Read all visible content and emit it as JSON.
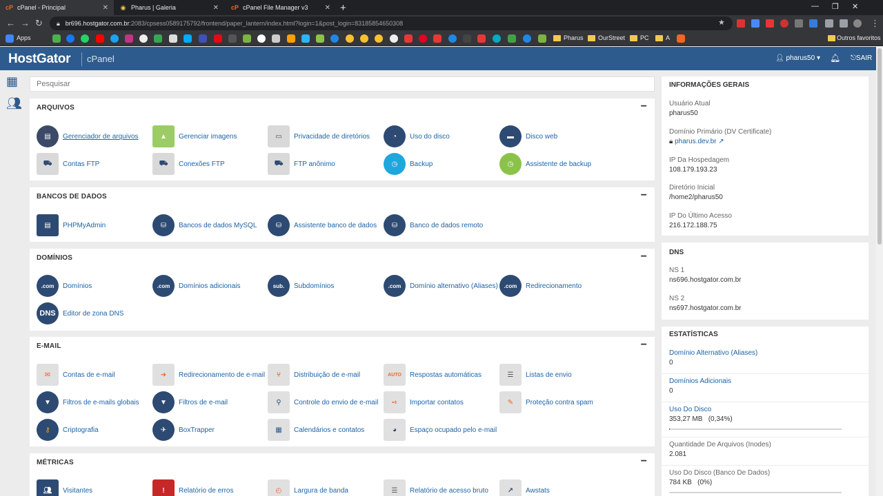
{
  "browser": {
    "tabs": [
      {
        "title": "cPanel - Principal",
        "active": true,
        "icon": "cpanel-icon"
      },
      {
        "title": "Pharus | Galeria",
        "active": false,
        "icon": "pharus-icon"
      },
      {
        "title": "cPanel File Manager v3",
        "active": false,
        "icon": "cpanel-icon"
      }
    ],
    "url_host": "br696.hostgator.com.br",
    "url_rest": ":2083/cpsess0589175792/frontend/paper_lantern/index.html?login=1&post_login=83185854650308",
    "bookmarks": {
      "apps": "Apps",
      "folders": [
        "Pharus",
        "OurStreet",
        "PC",
        "A"
      ],
      "other": "Outros favoritos"
    }
  },
  "header": {
    "logo": "HostGator",
    "sub": "cPanel",
    "user": "pharus50",
    "exit": "SAIR"
  },
  "search": {
    "placeholder": "Pesquisar"
  },
  "sections": {
    "arquivos": {
      "title": "ARQUIVOS",
      "items": [
        "Gerenciador de arquivos",
        "Gerenciar imagens",
        "Privacidade de diretórios",
        "Uso do disco",
        "Disco web",
        "Contas FTP",
        "Conexões FTP",
        "FTP anônimo",
        "Backup",
        "Assistente de backup"
      ]
    },
    "bancos": {
      "title": "BANCOS DE DADOS",
      "items": [
        "PHPMyAdmin",
        "Bancos de dados MySQL",
        "Assistente banco de dados",
        "Banco de dados remoto"
      ]
    },
    "dominios": {
      "title": "DOMÍNIOS",
      "items": [
        "Domínios",
        "Domínios adicionais",
        "Subdomínios",
        "Domínio alternativo (Aliases)",
        "Redirecionamento",
        "Editor de zona DNS"
      ],
      "icon_text": [
        ".com",
        ".com",
        "sub.",
        ".com",
        ".com",
        "DNS"
      ]
    },
    "email": {
      "title": "E-MAIL",
      "items": [
        "Contas de e-mail",
        "Redirecionamento de e-mail",
        "Distribuição de e-mail",
        "Respostas automáticas",
        "Listas de envio",
        "Filtros de e-mails globais",
        "Filtros de e-mail",
        "Controle do envio de e-mail",
        "Importar contatos",
        "Proteção contra spam",
        "Criptografia",
        "BoxTrapper",
        "Calendários e contatos",
        "Espaço ocupado pelo e-mail"
      ],
      "icon_text": [
        "AUTO"
      ]
    },
    "metricas": {
      "title": "MÉTRICAS",
      "items": [
        "Visitantes",
        "Relatório de erros",
        "Largura de banda",
        "Relatório de acesso bruto",
        "Awstats"
      ]
    }
  },
  "info": {
    "title": "INFORMAÇÕES GERAIS",
    "current_user_label": "Usuário Atual",
    "current_user": "pharus50",
    "primary_domain_label": "Domínio Primário (DV Certificate)",
    "primary_domain": "pharus.dev.br",
    "ip_label": "IP Da Hospedagem",
    "ip": "108.179.193.23",
    "home_label": "Diretório Inicial",
    "home": "/home2/pharus50",
    "last_ip_label": "IP Do Último Acesso",
    "last_ip": "216.172.188.75"
  },
  "dns": {
    "title": "DNS",
    "ns1_label": "NS 1",
    "ns1": "ns696.hostgator.com.br",
    "ns2_label": "NS 2",
    "ns2": "ns697.hostgator.com.br"
  },
  "stats": {
    "title": "ESTATÍSTICAS",
    "aliases_label": "Domínio Alternativo (Aliases)",
    "aliases": "0",
    "addon_label": "Domínios Adicionais",
    "addon": "0",
    "disk_label": "Uso Do Disco",
    "disk": "353,27 MB   (0,34%)",
    "disk_fraction": 0.0034,
    "inodes_label": "Quantidade De Arquivos (Inodes)",
    "inodes": "2.081",
    "db_disk_label": "Uso Do Disco (Banco De Dados)",
    "db_disk": "784 KB   (0%)"
  },
  "colors": {
    "header": "#2d5b8e",
    "link": "#1d63a6",
    "accent": "#f26522"
  }
}
